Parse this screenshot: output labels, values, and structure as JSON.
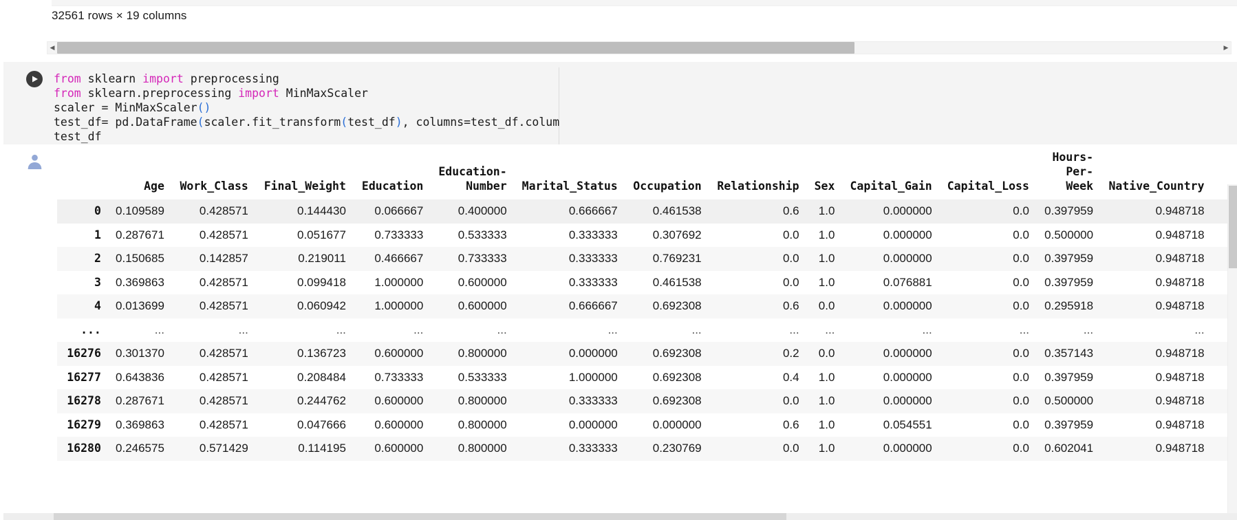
{
  "output_meta": {
    "rows_columns": "32561 rows × 19 columns"
  },
  "scrollbar": {
    "left_arrow": "◀",
    "right_arrow": "▶"
  },
  "code_cell": {
    "run_icon": "play-icon",
    "lines": [
      {
        "parts": [
          {
            "t": "from ",
            "c": "kw"
          },
          {
            "t": "sklearn ",
            "c": "op"
          },
          {
            "t": "import ",
            "c": "kw"
          },
          {
            "t": "preprocessing",
            "c": "op"
          }
        ]
      },
      {
        "parts": [
          {
            "t": "from ",
            "c": "kw"
          },
          {
            "t": "sklearn.preprocessing ",
            "c": "op"
          },
          {
            "t": "import ",
            "c": "kw"
          },
          {
            "t": "MinMaxScaler",
            "c": "op"
          }
        ]
      },
      {
        "parts": [
          {
            "t": "scaler = ",
            "c": "op"
          },
          {
            "t": "MinMaxScaler",
            "c": "op"
          },
          {
            "t": "()",
            "c": "fn"
          }
        ]
      },
      {
        "parts": [
          {
            "t": "test_df= pd.DataFrame",
            "c": "op"
          },
          {
            "t": "(",
            "c": "fn"
          },
          {
            "t": "scaler.fit_transform",
            "c": "op"
          },
          {
            "t": "(",
            "c": "fn"
          },
          {
            "t": "test_df",
            "c": "op"
          },
          {
            "t": ")",
            "c": "fn"
          },
          {
            "t": ", columns=test_df.columns",
            "c": "op"
          },
          {
            "t": ")",
            "c": "fn"
          }
        ]
      },
      {
        "parts": [
          {
            "t": "test_df",
            "c": "op"
          }
        ]
      }
    ]
  },
  "dataframe": {
    "avatar_icon": "user-avatar-icon",
    "columns": [
      "Age",
      "Work_Class",
      "Final_Weight",
      "Education",
      "Education-Number",
      "Marital_Status",
      "Occupation",
      "Relationship",
      "Sex",
      "Capital_Gain",
      "Capital_Loss",
      "Hours-Per-Week",
      "Native_Country"
    ],
    "rows": [
      {
        "index": "0",
        "values": [
          "0.109589",
          "0.428571",
          "0.144430",
          "0.066667",
          "0.400000",
          "0.666667",
          "0.461538",
          "0.6",
          "1.0",
          "0.000000",
          "0.0",
          "0.397959",
          "0.948718"
        ]
      },
      {
        "index": "1",
        "values": [
          "0.287671",
          "0.428571",
          "0.051677",
          "0.733333",
          "0.533333",
          "0.333333",
          "0.307692",
          "0.0",
          "1.0",
          "0.000000",
          "0.0",
          "0.500000",
          "0.948718"
        ]
      },
      {
        "index": "2",
        "values": [
          "0.150685",
          "0.142857",
          "0.219011",
          "0.466667",
          "0.733333",
          "0.333333",
          "0.769231",
          "0.0",
          "1.0",
          "0.000000",
          "0.0",
          "0.397959",
          "0.948718"
        ]
      },
      {
        "index": "3",
        "values": [
          "0.369863",
          "0.428571",
          "0.099418",
          "1.000000",
          "0.600000",
          "0.333333",
          "0.461538",
          "0.0",
          "1.0",
          "0.076881",
          "0.0",
          "0.397959",
          "0.948718"
        ]
      },
      {
        "index": "4",
        "values": [
          "0.013699",
          "0.428571",
          "0.060942",
          "1.000000",
          "0.600000",
          "0.666667",
          "0.692308",
          "0.6",
          "0.0",
          "0.000000",
          "0.0",
          "0.295918",
          "0.948718"
        ]
      },
      {
        "index": "...",
        "values": [
          "...",
          "...",
          "...",
          "...",
          "...",
          "...",
          "...",
          "...",
          "...",
          "...",
          "...",
          "...",
          "..."
        ],
        "ellipsis": true
      },
      {
        "index": "16276",
        "values": [
          "0.301370",
          "0.428571",
          "0.136723",
          "0.600000",
          "0.800000",
          "0.000000",
          "0.692308",
          "0.2",
          "0.0",
          "0.000000",
          "0.0",
          "0.357143",
          "0.948718"
        ]
      },
      {
        "index": "16277",
        "values": [
          "0.643836",
          "0.428571",
          "0.208484",
          "0.733333",
          "0.533333",
          "1.000000",
          "0.692308",
          "0.4",
          "1.0",
          "0.000000",
          "0.0",
          "0.397959",
          "0.948718"
        ]
      },
      {
        "index": "16278",
        "values": [
          "0.287671",
          "0.428571",
          "0.244762",
          "0.600000",
          "0.800000",
          "0.333333",
          "0.692308",
          "0.0",
          "1.0",
          "0.000000",
          "0.0",
          "0.500000",
          "0.948718"
        ]
      },
      {
        "index": "16279",
        "values": [
          "0.369863",
          "0.428571",
          "0.047666",
          "0.600000",
          "0.800000",
          "0.000000",
          "0.000000",
          "0.6",
          "1.0",
          "0.054551",
          "0.0",
          "0.397959",
          "0.948718"
        ]
      },
      {
        "index": "16280",
        "values": [
          "0.246575",
          "0.571429",
          "0.114195",
          "0.600000",
          "0.800000",
          "0.333333",
          "0.230769",
          "0.0",
          "1.0",
          "0.000000",
          "0.0",
          "0.602041",
          "0.948718"
        ]
      }
    ]
  }
}
